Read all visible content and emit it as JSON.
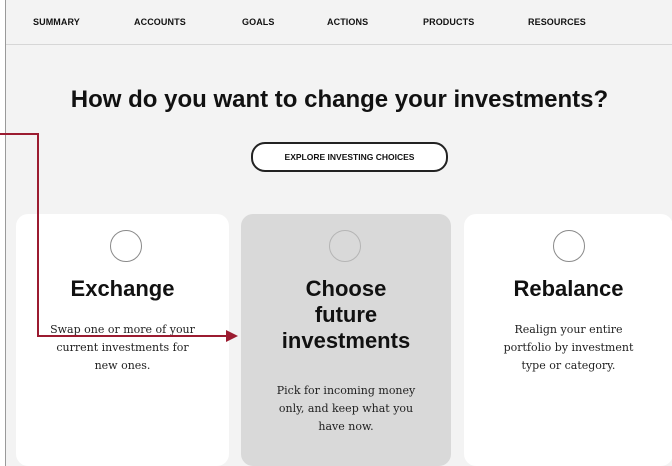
{
  "nav": {
    "items": [
      {
        "label": "SUMMARY"
      },
      {
        "label": "ACCOUNTS"
      },
      {
        "label": "GOALS"
      },
      {
        "label": "ACTIONS"
      },
      {
        "label": "PRODUCTS"
      },
      {
        "label": "RESOURCES"
      }
    ]
  },
  "headline": "How do you want to change your investments?",
  "explore_button": "EXPLORE INVESTING CHOICES",
  "cards": [
    {
      "title_lines": [
        "Exchange"
      ],
      "desc_lines": [
        "Swap one or more of your",
        "current investments for",
        "new ones."
      ],
      "selected": false
    },
    {
      "title_lines": [
        "Choose",
        "future",
        "investments"
      ],
      "desc_lines": [
        "Pick for incoming money",
        "only, and keep what you",
        "have now."
      ],
      "selected": true
    },
    {
      "title_lines": [
        "Rebalance"
      ],
      "desc_lines": [
        "Realign your entire",
        "portfolio by investment",
        "type or category."
      ],
      "selected": false
    }
  ],
  "colors": {
    "arrow": "#9b1b30",
    "selected_card": "#d9d9d9",
    "background": "#f3f3f3"
  }
}
